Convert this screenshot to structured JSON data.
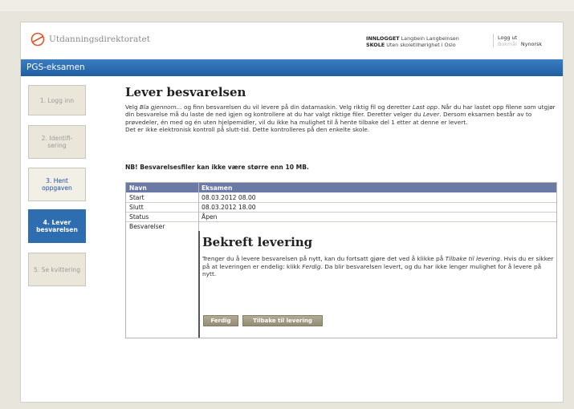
{
  "header": {
    "logo_text": "Utdanningsdirektoratet",
    "logged_in_label": "INNLOGGET",
    "logged_in_name": "Langbein Langbeinsen",
    "school_label": "SKOLE",
    "school_value": "Uten skoletilhørighet i Oslo",
    "logout": "Logg ut",
    "lang_bokmal": "Bokmål",
    "lang_nynorsk": "Nynorsk"
  },
  "app_title": "PGS-eksamen",
  "steps": [
    {
      "label": "1. Logg inn",
      "state": "done"
    },
    {
      "label": "2. Identifi-\nsering",
      "state": "done"
    },
    {
      "label": "3. Hent\noppgaven",
      "state": "next"
    },
    {
      "label": "4. Lever\nbesvarelsen",
      "state": "active"
    },
    {
      "label": "5. Se kvittering",
      "state": "todo"
    }
  ],
  "main": {
    "title": "Lever besvarelsen",
    "intro_1": "Velg ",
    "intro_bla": "Bla gjennom...",
    "intro_2": " og finn besvarelsen du vil levere på din datamaskin. Velg riktig fil og deretter ",
    "intro_last": "Last opp",
    "intro_3": ". Når du har lastet opp filene som utgjør din besvarelse må du laste de ned igjen og kontrollere at du har valgt riktige filer. Deretter velger du ",
    "intro_lever": "Lever",
    "intro_4": ". Dersom eksamen består av to prøvedeler, én med og én uten hjelpemidler, vil du ikke ha mulighet til å hente tilbake del 1 etter at denne er levert.",
    "intro_5": "Det er ikke elektronisk kontroll på slutt-tid. Dette kontrolleres på den enkelte skole.",
    "nb": "NB! Besvarelsesfiler kan ikke være større enn 10 MB."
  },
  "table": {
    "header": [
      "Navn",
      "Eksamen"
    ],
    "rows": [
      [
        "Start",
        "08.03.2012 08.00"
      ],
      [
        "Slutt",
        "08.03.2012 18.00"
      ],
      [
        "Status",
        "Åpen"
      ],
      [
        "Besvarelser",
        ""
      ]
    ]
  },
  "confirm": {
    "title": "Bekreft levering",
    "text_1": "Trenger du å levere besvarelsen på nytt, kan du fortsatt gjøre det ved å klikke på ",
    "text_tilbake": "Tilbake til levering",
    "text_2": ". Hvis du er sikker på at leveringen er endelig: klikk ",
    "text_ferdig": "Ferdig",
    "text_3": ". Da blir besvarelsen levert, og du har ikke lenger mulighet for å levere på nytt.",
    "btn_ferdig": "Ferdig",
    "btn_tilbake": "Tilbake til levering"
  }
}
